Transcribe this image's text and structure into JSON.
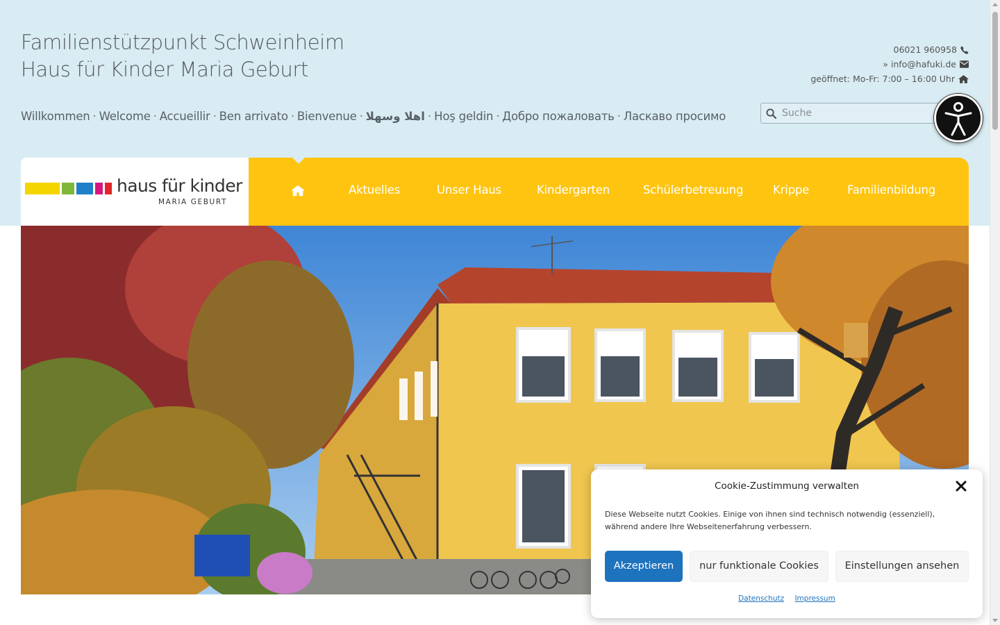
{
  "site": {
    "title_line1": "Familienstützpunkt Schweinheim",
    "title_line2": "Haus für Kinder Maria Geburt"
  },
  "contact": {
    "phone": "06021 960958",
    "email": "» info@hafuki.de",
    "hours": "geöffnet: Mo-Fr: 7:00 – 16:00 Uhr"
  },
  "languages": {
    "separator": "·",
    "items": [
      "Willkommen",
      "Welcome",
      "Accueillir",
      "Ben arrivato",
      "Bienvenue",
      "اهلا وسهلا",
      "Hoş geldin",
      "Добро пожаловать",
      "Ласкаво просимо"
    ]
  },
  "search": {
    "placeholder": "Suche"
  },
  "logo": {
    "text": "haus für kinder",
    "subtext": "MARIA GEBURT"
  },
  "nav": {
    "home_icon": "home-icon",
    "items": [
      "Aktuelles",
      "Unser Haus",
      "Kindergarten",
      "Schülerbetreuung",
      "Krippe",
      "Familienbildung"
    ]
  },
  "cookie": {
    "title": "Cookie-Zustimmung verwalten",
    "text": "Diese Webseite nutzt Cookies. Einige von ihnen sind technisch notwendig (essenziell), während andere Ihre Webseitenerfahrung verbessern.",
    "accept": "Akzeptieren",
    "functional": "nur funktionale Cookies",
    "settings": "Einstellungen ansehen",
    "privacy_link": "Datenschutz",
    "imprint_link": "Impressum"
  },
  "colors": {
    "header_bg": "#d9ecf3",
    "nav_bg": "#fec40f",
    "primary_button": "#1e73be",
    "logo_yellow": "#f5d500",
    "logo_green": "#7fb839",
    "logo_blue": "#1f7fc8",
    "logo_magenta": "#d6177e",
    "logo_red": "#e3242b"
  }
}
